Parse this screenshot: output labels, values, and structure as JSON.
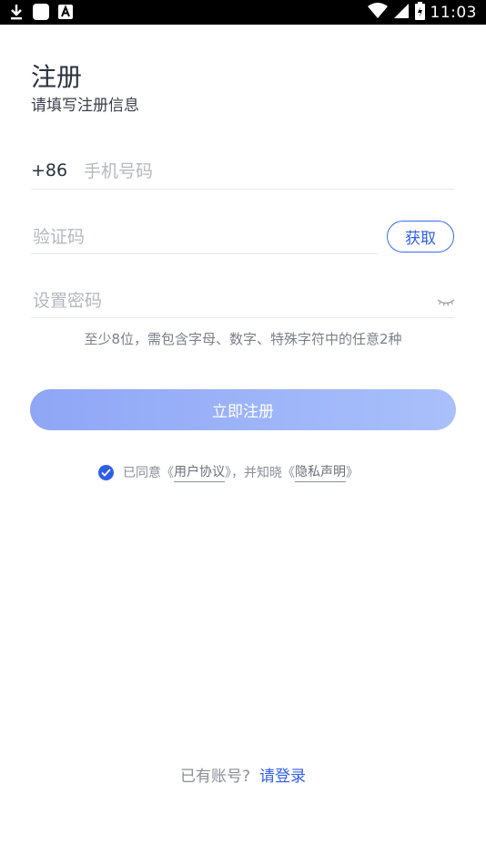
{
  "status_bar": {
    "time": "11:03",
    "icons": [
      "download-icon",
      "app-icon",
      "a-notification-icon",
      "wifi-icon",
      "signal-icon",
      "battery-icon"
    ]
  },
  "page": {
    "title": "注册",
    "subtitle": "请填写注册信息"
  },
  "form": {
    "country_code": "+86",
    "phone_placeholder": "手机号码",
    "code_placeholder": "验证码",
    "get_code_label": "获取",
    "password_placeholder": "设置密码",
    "password_hint": "至少8位，需包含字母、数字、特殊字符中的任意2种",
    "register_label": "立即注册"
  },
  "agreement": {
    "checked": true,
    "prefix": "已同意《",
    "user_agreement": "用户协议",
    "middle": "》，并知晓《",
    "privacy": "隐私声明",
    "suffix": "》"
  },
  "footer": {
    "question": "已有账号?",
    "login_link": "请登录"
  },
  "colors": {
    "accent": "#2f5fe8",
    "button_gradient_start": "#8fa6f6",
    "button_gradient_end": "#a9c0fb"
  }
}
